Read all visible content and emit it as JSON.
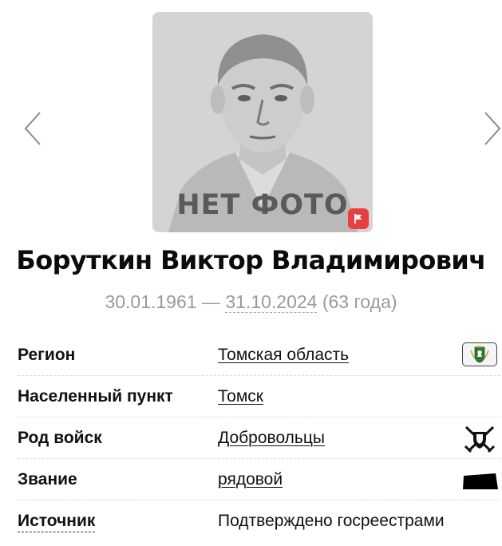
{
  "photo": {
    "placeholder_text": "НЕТ ФОТО",
    "flag_icon": "flag-icon",
    "bg_color": "#d6d6d6",
    "flag_color": "#e9403f"
  },
  "nav": {
    "prev_icon": "chevron-left-icon",
    "next_icon": "chevron-right-icon"
  },
  "person": {
    "name": "Боруткин Виктор Владимирович",
    "birth": "30.01.1961",
    "separator": " — ",
    "death": "31.10.2024",
    "age": " (63 года)"
  },
  "info": {
    "region": {
      "label": "Регион",
      "value": "Томская область",
      "icon": "region-emblem-icon"
    },
    "settlement": {
      "label": "Населенный пункт",
      "value": "Томск"
    },
    "troops": {
      "label": "Род войск",
      "value": "Добровольцы",
      "icon": "crossed-swords-shield-icon"
    },
    "rank": {
      "label": "Звание",
      "value": "рядовой",
      "icon": "rank-insignia-icon"
    },
    "source": {
      "label": "Источник",
      "value": "Подтверждено госреестрами"
    }
  }
}
